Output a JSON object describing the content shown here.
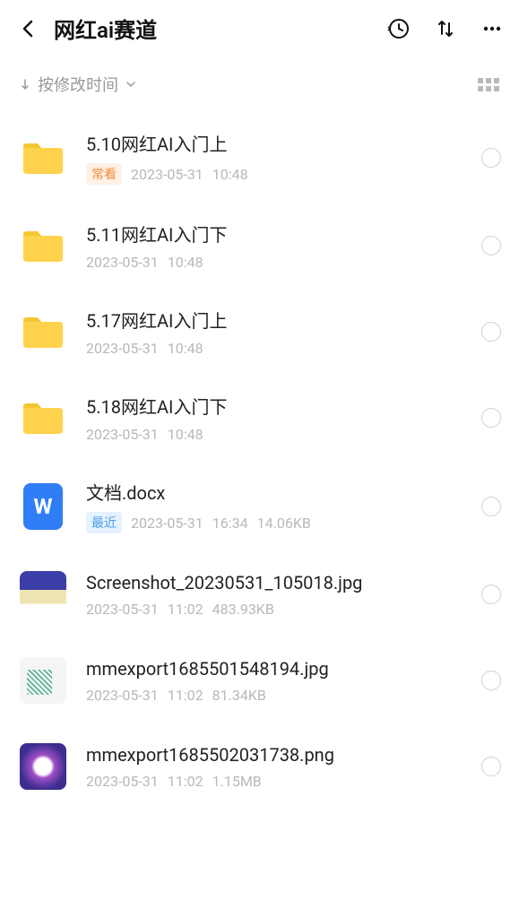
{
  "header": {
    "title": "网红ai赛道"
  },
  "sort": {
    "label": "按修改时间"
  },
  "badges": {
    "frequent": "常看",
    "recent": "最近"
  },
  "files": [
    {
      "name": "5.10网红AI入门上",
      "date": "2023-05-31",
      "time": "10:48",
      "size": "",
      "type": "folder",
      "badge": "frequent"
    },
    {
      "name": "5.11网红AI入门下",
      "date": "2023-05-31",
      "time": "10:48",
      "size": "",
      "type": "folder",
      "badge": ""
    },
    {
      "name": "5.17网红AI入门上",
      "date": "2023-05-31",
      "time": "10:48",
      "size": "",
      "type": "folder",
      "badge": ""
    },
    {
      "name": "5.18网红AI入门下",
      "date": "2023-05-31",
      "time": "10:48",
      "size": "",
      "type": "folder",
      "badge": ""
    },
    {
      "name": "文档.docx",
      "date": "2023-05-31",
      "time": "16:34",
      "size": "14.06KB",
      "type": "docx",
      "badge": "recent"
    },
    {
      "name": "Screenshot_20230531_105018.jpg",
      "date": "2023-05-31",
      "time": "11:02",
      "size": "483.93KB",
      "type": "image1",
      "badge": ""
    },
    {
      "name": "mmexport1685501548194.jpg",
      "date": "2023-05-31",
      "time": "11:02",
      "size": "81.34KB",
      "type": "image2",
      "badge": ""
    },
    {
      "name": "mmexport1685502031738.png",
      "date": "2023-05-31",
      "time": "11:02",
      "size": "1.15MB",
      "type": "image3",
      "badge": ""
    }
  ]
}
